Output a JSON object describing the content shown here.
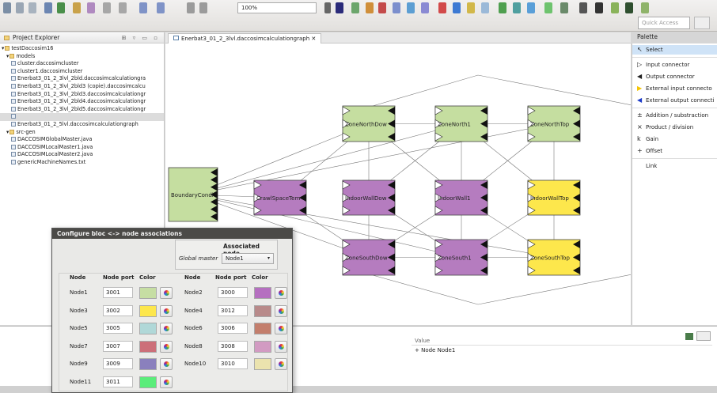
{
  "toolbar": {
    "zoom": "100%",
    "quick_access_placeholder": "Quick Access"
  },
  "explorer": {
    "title": "Project Explorer",
    "items": [
      {
        "label": "testDaccosim16",
        "indent": 0,
        "folder": true
      },
      {
        "label": "models",
        "indent": 1,
        "folder": true
      },
      {
        "label": "cluster.daccosimcluster",
        "indent": 2
      },
      {
        "label": "cluster1.daccosimcluster",
        "indent": 2
      },
      {
        "label": "Enerbat3_01_2_3lvl_2bld.daccosimcalculationgra",
        "indent": 2
      },
      {
        "label": "Enerbat3_01_2_3lvl_2bld3 (copie).daccosimcalcu",
        "indent": 2
      },
      {
        "label": "Enerbat3_01_2_3lvl_2bld3.daccosimcalculationgr",
        "indent": 2
      },
      {
        "label": "Enerbat3_01_2_3lvl_2bld4.daccosimcalculationgr",
        "indent": 2
      },
      {
        "label": "Enerbat3_01_2_3lvl_2bld5.daccosimcalculationgr",
        "indent": 2
      },
      {
        "label": "Enerbat3_01_2_3lvl.daccosimcalculationgraph",
        "indent": 2,
        "selected": true
      },
      {
        "label": "Enerbat3_01_2_5lvl.daccosimcalculationgraph",
        "indent": 2
      },
      {
        "label": "src-gen",
        "indent": 1,
        "folder": true
      },
      {
        "label": "DACCOSIMGlobalMaster.java",
        "indent": 2
      },
      {
        "label": "DACCOSIMLocalMaster1.java",
        "indent": 2
      },
      {
        "label": "DACCOSIMLocalMaster2.java",
        "indent": 2
      },
      {
        "label": "genericMachineNames.txt",
        "indent": 2
      }
    ]
  },
  "editor": {
    "tab_label": "Enerbat3_01_2_3lvl.daccosimcalculationgraph"
  },
  "graph": {
    "blocks": [
      {
        "id": "boundary",
        "label": "BoundaryCondi",
        "color": "#c5dea0"
      },
      {
        "id": "crawl",
        "label": "CrawlSpaceTem",
        "color": "#b57cbf"
      },
      {
        "id": "nwd",
        "label": "ZoneNorthDow",
        "color": "#c5dea0"
      },
      {
        "id": "indoorwd",
        "label": "IndoorWallDow",
        "color": "#b57cbf"
      },
      {
        "id": "swd",
        "label": "ZoneSouthDow",
        "color": "#b57cbf"
      },
      {
        "id": "n1",
        "label": "ZoneNorth1",
        "color": "#c5dea0"
      },
      {
        "id": "iw1",
        "label": "IndoorWall1",
        "color": "#b57cbf"
      },
      {
        "id": "s1",
        "label": "ZoneSouth1",
        "color": "#b57cbf"
      },
      {
        "id": "ntop",
        "label": "ZoneNorthTop",
        "color": "#c5dea0"
      },
      {
        "id": "iwtop",
        "label": "IndoorWallTop",
        "color": "#fde74c"
      },
      {
        "id": "stop",
        "label": "ZoneSouthTop",
        "color": "#fde74c"
      }
    ]
  },
  "palette": {
    "title": "Palette",
    "items": [
      {
        "label": "Select",
        "glyph": "↖",
        "selected": true
      },
      {
        "label": "Input connector",
        "glyph": "▷"
      },
      {
        "label": "Output connector",
        "glyph": "◀"
      },
      {
        "label": "External input connecto",
        "glyph": "▶",
        "color": "#f5c400"
      },
      {
        "label": "External output connecti",
        "glyph": "◀",
        "color": "#1e3cc8"
      },
      {
        "label": "Addition / substraction",
        "glyph": "±"
      },
      {
        "label": "Product / division",
        "glyph": "×"
      },
      {
        "label": "Gain",
        "glyph": "k"
      },
      {
        "label": "Offset",
        "glyph": "+"
      },
      {
        "label": "Link",
        "glyph": ""
      }
    ]
  },
  "properties": {
    "value_header": "Value",
    "value_row": "+ Node Node1"
  },
  "dialog": {
    "title": "Configure bloc <-> node associations",
    "assoc_label": "Associated node",
    "global_master_label": "Global master",
    "global_master_value": "Node1",
    "headers": {
      "node": "Node",
      "port": "Node port",
      "color": "Color"
    },
    "nodes": [
      {
        "name": "Node1",
        "port": "3001",
        "color": "#c6dea3"
      },
      {
        "name": "Node2",
        "port": "3000",
        "color": "#b56fc0"
      },
      {
        "name": "Node3",
        "port": "3002",
        "color": "#fde74c"
      },
      {
        "name": "Node4",
        "port": "3012",
        "color": "#b88a8a"
      },
      {
        "name": "Node5",
        "port": "3005",
        "color": "#b0d8d8"
      },
      {
        "name": "Node6",
        "port": "3006",
        "color": "#c37e6c"
      },
      {
        "name": "Node7",
        "port": "3007",
        "color": "#cc6f79"
      },
      {
        "name": "Node8",
        "port": "3008",
        "color": "#d29bc2"
      },
      {
        "name": "Node9",
        "port": "3009",
        "color": "#8a80bd"
      },
      {
        "name": "Node10",
        "port": "3010",
        "color": "#ebe3ae"
      },
      {
        "name": "Node11",
        "port": "3011",
        "color": "#5aed7a"
      }
    ]
  }
}
